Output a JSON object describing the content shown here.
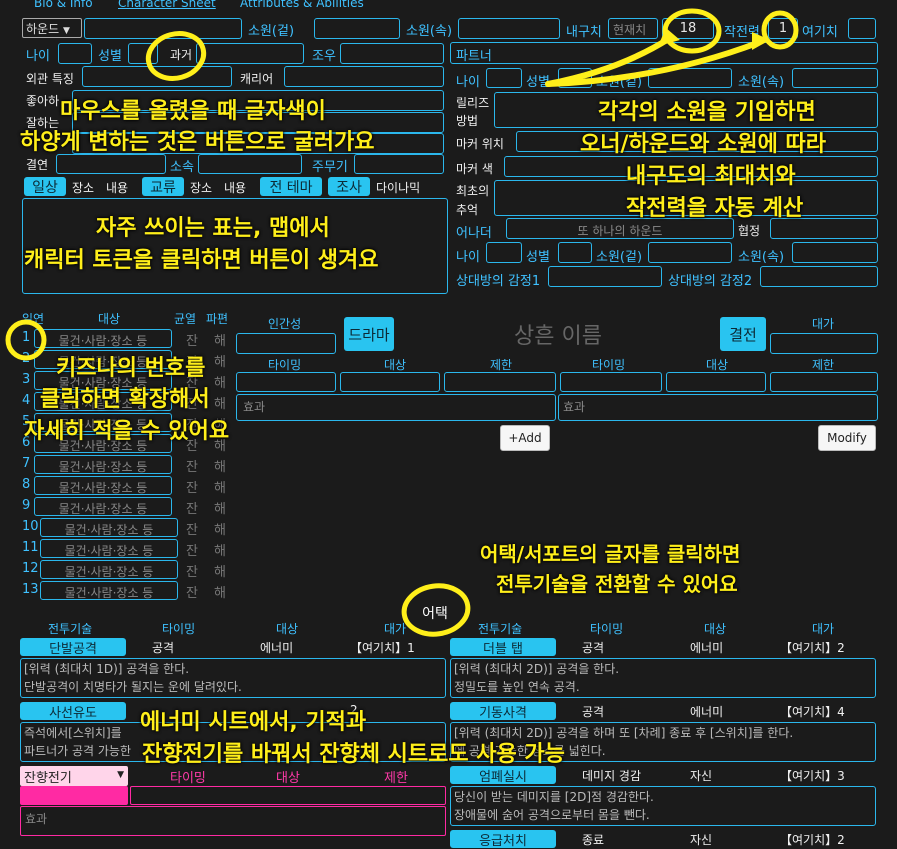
{
  "tabs": [
    "Bio & Info",
    "Character Sheet",
    "Attributes & Abilities"
  ],
  "header": {
    "role_select": "하운드",
    "wish_outer": "소원(겉)",
    "wish_inner": "소원(속)",
    "durability": "내구치",
    "current_placeholder": "현재치",
    "durability_value": "18",
    "battle_power": "작전력",
    "battle_value": "1",
    "miracle": "여기치"
  },
  "profile": {
    "age": "나이",
    "gender": "성별",
    "past": "과거",
    "condition": "조우",
    "appearance": "외관 특징",
    "career": "캐리어",
    "likes": "좋아하",
    "good_at": "잘하는",
    "family": "결연",
    "belonging": "소속",
    "weapon": "주무기"
  },
  "partner": {
    "title": "파트너",
    "age": "나이",
    "gender": "성별",
    "wish_outer": "소원(겉)",
    "wish_inner": "소원(속)",
    "relationship": "릴리즈",
    "method": "방법",
    "marker_pos": "마커 위치",
    "marker_color": "마커 색",
    "first_memory": "최초의",
    "memory": "추억",
    "owner": "어나더",
    "owner_placeholder": "또 하나의 하운드",
    "cooperation": "협정",
    "age2": "나이",
    "gender2": "성별",
    "wish_outer2": "소원(겉)",
    "wish_inner2": "소원(속)",
    "emotion1": "상대방의 감정1",
    "emotion2": "상대방의 감정2"
  },
  "quick_tabs": [
    "일상",
    "장소",
    "내용",
    "교류",
    "장소",
    "내용",
    "전 테마",
    "조사",
    "다이나믹"
  ],
  "quickref": {
    "head_num": "일연",
    "head_target": "대상",
    "head_crack": "균열",
    "head_break": "파편",
    "placeholder": "물건·사람·장소 등",
    "crack": "잔",
    "break": "해",
    "numbers": [
      "1",
      "2",
      "3",
      "4",
      "5",
      "6",
      "7",
      "8",
      "9",
      "10",
      "11",
      "12",
      "13"
    ]
  },
  "soul": {
    "humanity": "인간성",
    "drama": "드라마",
    "name_placeholder": "상흔 이름",
    "battle": "결전",
    "cost": "대가",
    "timing": "타이밍",
    "target": "대상",
    "limit": "제한",
    "effect_left": "효과",
    "effect_right": "효과",
    "add": "+Add",
    "modify": "Modify"
  },
  "combat": {
    "headers": [
      "전투기술",
      "타이밍",
      "대상",
      "대가"
    ],
    "attack_label": "어택",
    "left": [
      {
        "name": "단발공격",
        "timing": "공격",
        "target": "에너미",
        "cost": "【여기치】1",
        "desc": [
          "[위력 (최대치 1D)] 공격을 한다.",
          "단발공격이 치명타가 될지는 운에 달려있다."
        ]
      },
      {
        "name": "사선유도",
        "timing": "",
        "target": "",
        "cost": "2",
        "desc": [
          "즉석에서[스위치]를",
          "파트너가 공격 가능한"
        ]
      }
    ],
    "right": [
      {
        "name": "더블 탭",
        "timing": "공격",
        "target": "에너미",
        "cost": "【여기치】2",
        "desc": [
          "[위력 (최대치 2D)] 공격을 한다.",
          "정밀도를 높인 연속 공격."
        ]
      },
      {
        "name": "기동사격",
        "timing": "공격",
        "target": "에너미",
        "cost": "【여기치】4",
        "desc": [
          "[위력 (최대치 2D)] 공격을 하며 또 [차례] 종료 후 [스위치]를 한다.",
          "에 공격 가능한 장소를 넓힌다."
        ]
      },
      {
        "name": "엄폐실시",
        "timing": "데미지 경감",
        "target": "자신",
        "cost": "【여기치】3",
        "desc": [
          "당신이 받는 데미지를 [2D]점 경감한다.",
          "장애물에 숨어 공격으로부터 몸을 뺀다."
        ]
      },
      {
        "name": "응급처치",
        "timing": "종료",
        "target": "자신",
        "cost": "【여기치】2",
        "desc": []
      }
    ],
    "pink": {
      "select": "잔향전기",
      "timing": "타이밍",
      "target": "대상",
      "limit": "제한",
      "effect": "효과"
    }
  },
  "annotations": {
    "hover": [
      "마우스를 올렸을 때 글자색이",
      "하양게 변하는 것은 버튼으로 굴러가요"
    ],
    "wish": [
      "각각의 소원을 기입하면",
      "오너/하운드와 소원에 따라",
      "내구도의 최대치와",
      "작전력을 자동 계산"
    ],
    "table": [
      "자주 쓰이는 표는, 맵에서",
      "캐릭터 토큰을 클릭하면 버튼이 생겨요"
    ],
    "kizuna": [
      "키즈나의 번호를",
      "클릭하면 확장해서",
      "자세히 적을 수 있어요"
    ],
    "attack": [
      "어택/서포트의 글자를 클릭하면",
      "전투기술을 전환할 수 있어요"
    ],
    "enemy": [
      "에너미 시트에서, 기적과",
      "잔향전기를 바꿔서 잔향체 시트로도 사용 가능"
    ]
  }
}
